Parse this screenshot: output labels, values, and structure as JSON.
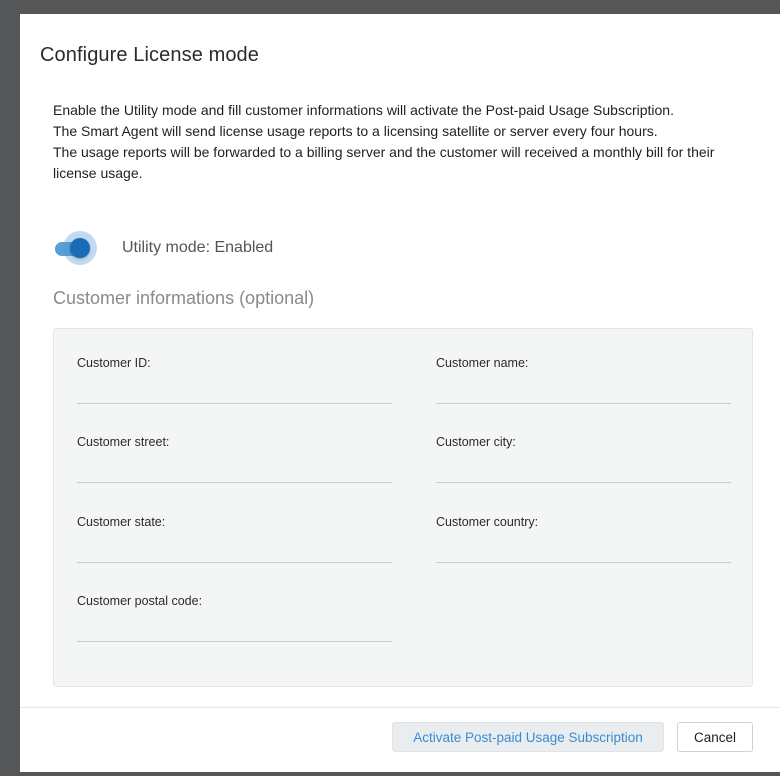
{
  "dialog": {
    "title": "Configure License mode",
    "description": [
      "Enable the Utility mode and fill customer informations will activate the Post-paid Usage Subscription.",
      "The Smart Agent will send license usage reports to a licensing satellite or server every four hours.",
      "The usage reports will be forwarded to a billing server and the customer will received a monthly bill for their license usage."
    ],
    "toggle": {
      "label": "Utility mode: Enabled",
      "enabled": true
    },
    "section_title": "Customer informations (optional)",
    "fields": {
      "customer_id": {
        "label": "Customer ID:",
        "value": ""
      },
      "customer_name": {
        "label": "Customer name:",
        "value": ""
      },
      "customer_street": {
        "label": "Customer street:",
        "value": ""
      },
      "customer_city": {
        "label": "Customer city:",
        "value": ""
      },
      "customer_state": {
        "label": "Customer state:",
        "value": ""
      },
      "customer_country": {
        "label": "Customer country:",
        "value": ""
      },
      "customer_postal_code": {
        "label": "Customer postal code:",
        "value": ""
      }
    },
    "buttons": {
      "activate": "Activate Post-paid Usage Subscription",
      "cancel": "Cancel"
    }
  },
  "colors": {
    "accent": "#1b6cb8",
    "toggle_track": "#5b9fd6",
    "primary_text": "#3b8bd0",
    "backdrop": "#555658"
  }
}
